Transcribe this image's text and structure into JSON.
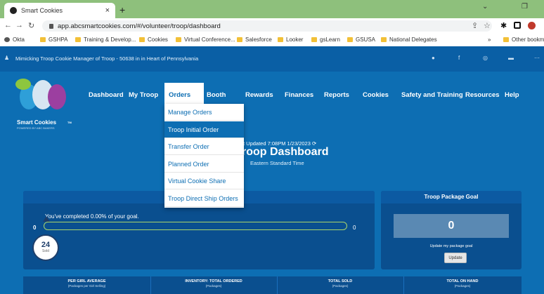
{
  "browser": {
    "tab_title": "Smart Cookies",
    "tab_close": "×",
    "new_tab": "+",
    "url": "app.abcsmartcookies.com/#/volunteer/troop/dashboard",
    "bookmarks": [
      "Okta",
      "GSHPA",
      "Training & Develop...",
      "Cookies",
      "Virtual Conference...",
      "Salesforce",
      "Looker",
      "gsLearn",
      "GSUSA",
      "National Delegates"
    ],
    "more_label": "»",
    "other_bookmarks": "Other bookma"
  },
  "banner": {
    "text": "Mimicking Troop Cookie Manager of Troop - 50638 in in Heart of Pennsylvania"
  },
  "logo": {
    "word": "Smart Cookies",
    "tm": "TM",
    "sub": "POWERED BY ABC BAKERS"
  },
  "nav": {
    "items": [
      "Dashboard",
      "My Troop",
      "Orders",
      "Booth",
      "Rewards",
      "Finances",
      "Reports",
      "Cookies",
      "Safety and Training",
      "Resources",
      "Help"
    ]
  },
  "orders_menu": {
    "items": [
      "Manage Orders",
      "Troop Initial Order",
      "Transfer Order",
      "Planned Order",
      "Virtual Cookie Share",
      "Troop Direct Ship Orders"
    ],
    "active_index": 1
  },
  "dashboard": {
    "updated": "t Updated 7:08PM 1/23/2023",
    "title": "roop Dashboard",
    "timezone": "Eastern Standard Time",
    "goal_text": "You've completed 0.00% of your goal.",
    "progress_start": "0",
    "progress_end": "0",
    "progress_fraction": 0,
    "sold_count": "24",
    "sold_label": "Sold"
  },
  "goal_panel": {
    "title": "Troop Package Goal",
    "value": "0",
    "subtitle": "Update my package goal",
    "button": "Update"
  },
  "stats": [
    {
      "title": "PER GIRL AVERAGE",
      "unit": "(Packages per Girl Selling)"
    },
    {
      "title": "INVENTORY: TOTAL ORDERED",
      "unit": "(Packages)"
    },
    {
      "title": "TOTAL SOLD",
      "unit": "(Packages)"
    },
    {
      "title": "TOTAL ON HAND",
      "unit": "(Packages)"
    }
  ],
  "colors": {
    "brand_blue": "#0d6eb3",
    "progress_border": "#a9d46b",
    "chrome_green": "#8ec07c"
  }
}
